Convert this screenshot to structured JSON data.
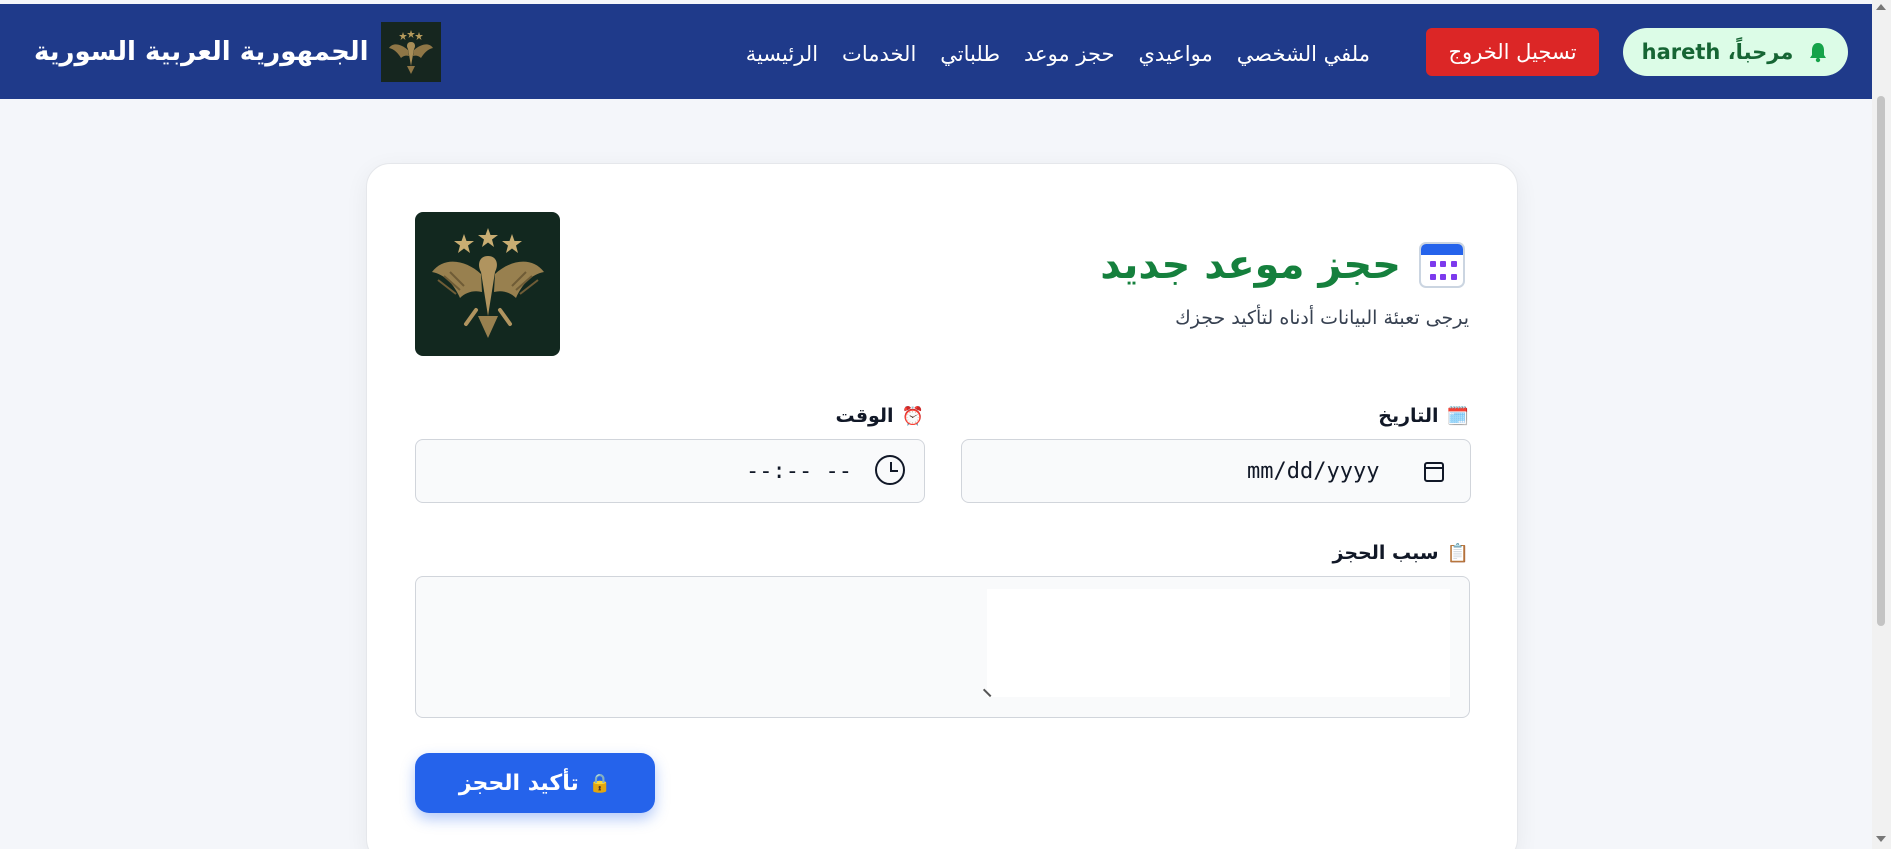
{
  "header": {
    "brand_title": "الجمهورية العربية السورية",
    "nav_links": [
      "الرئيسية",
      "الخدمات",
      "طلباتي",
      "حجز موعد",
      "مواعيدي",
      "ملفي الشخصي"
    ],
    "logout_label": "تسجيل الخروج",
    "welcome_text": "مرحباً، hareth",
    "welcome_icon": "bell-icon"
  },
  "form": {
    "title": "حجز موعد جديد",
    "subtitle": "يرجى تعبئة البيانات أدناه لتأكيد حجزك",
    "date_label": "التاريخ",
    "date_value": "mm/dd/yyyy",
    "time_label": "الوقت",
    "time_value": "--:-- --",
    "reason_label": "سبب الحجز",
    "reason_value": "",
    "submit_label": "تأكيد الحجز"
  },
  "colors": {
    "header_bg": "#1f3a8a",
    "logout_bg": "#dc2626",
    "title_green": "#15803d",
    "submit_blue": "#2563eb"
  }
}
